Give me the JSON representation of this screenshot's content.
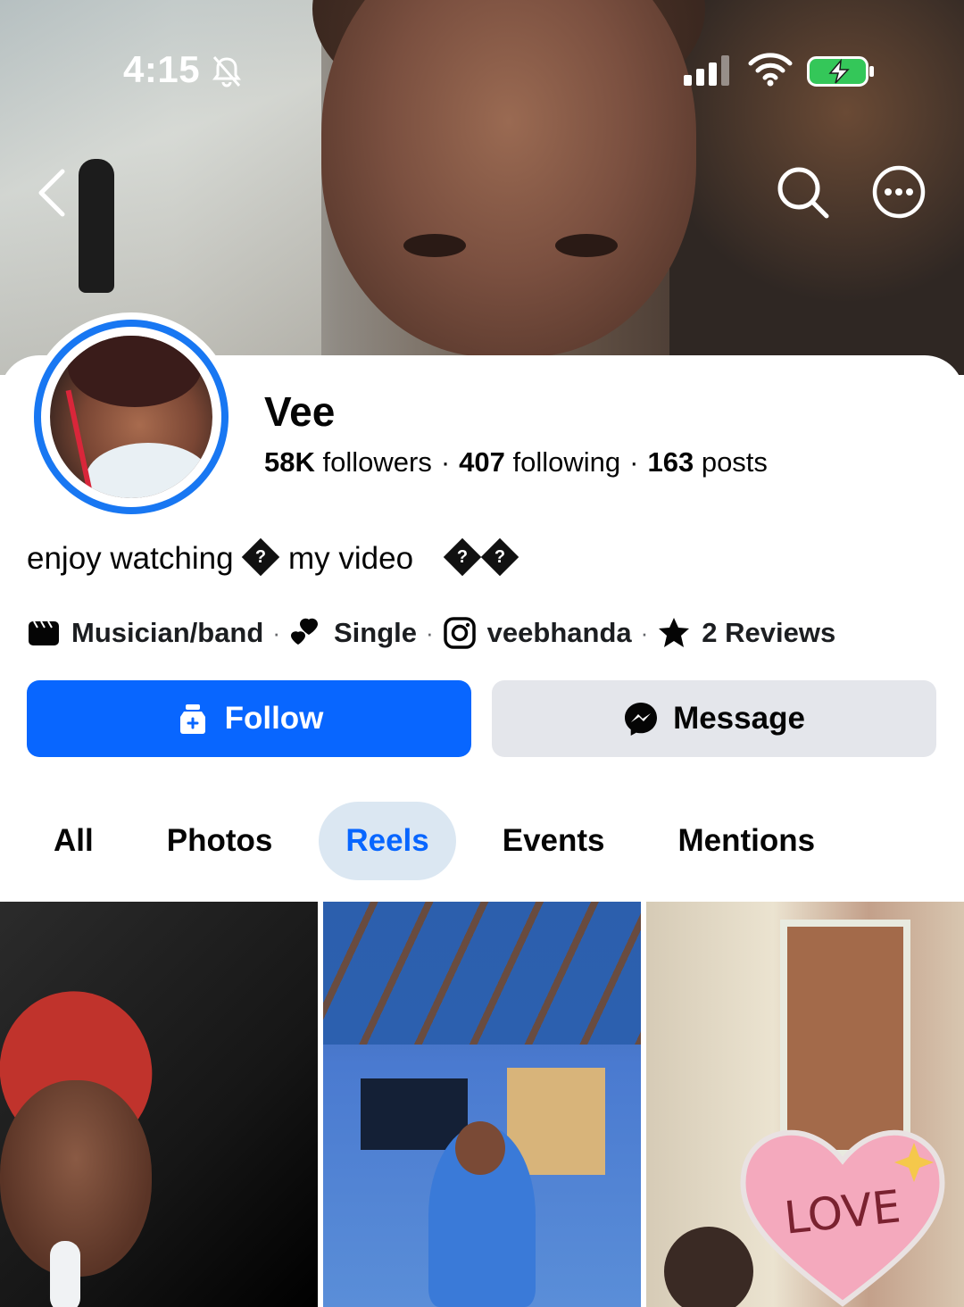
{
  "status_bar": {
    "time": "4:15"
  },
  "profile": {
    "name": "Vee",
    "followers_count": "58K",
    "followers_label": "followers",
    "following_count": "407",
    "following_label": "following",
    "posts_count": "163",
    "posts_label": "posts",
    "bio_text_1": "enjoy watching",
    "bio_text_2": "my video",
    "bio_glyph": "?"
  },
  "details": {
    "category": "Musician/band",
    "relationship": "Single",
    "instagram": "veebhanda",
    "reviews": "2 Reviews",
    "separator": "·"
  },
  "actions": {
    "follow_label": "Follow",
    "message_label": "Message"
  },
  "tabs": [
    {
      "label": "All"
    },
    {
      "label": "Photos"
    },
    {
      "label": "Reels"
    },
    {
      "label": "Events"
    },
    {
      "label": "Mentions"
    }
  ],
  "active_tab": "Reels",
  "reels": {
    "sticker_text": "LOVE"
  },
  "colors": {
    "accent": "#0866ff",
    "ring": "#1877f2",
    "active_tab_bg": "#dbe7f2",
    "secondary_button": "#e4e6eb"
  },
  "icons": {
    "back": "chevron-left-icon",
    "search": "search-icon",
    "more": "more-horizontal-icon",
    "category": "clapperboard-icon",
    "relationship": "hearts-icon",
    "instagram": "instagram-icon",
    "reviews": "star-icon",
    "follow": "add-friend-icon",
    "message": "messenger-icon"
  }
}
